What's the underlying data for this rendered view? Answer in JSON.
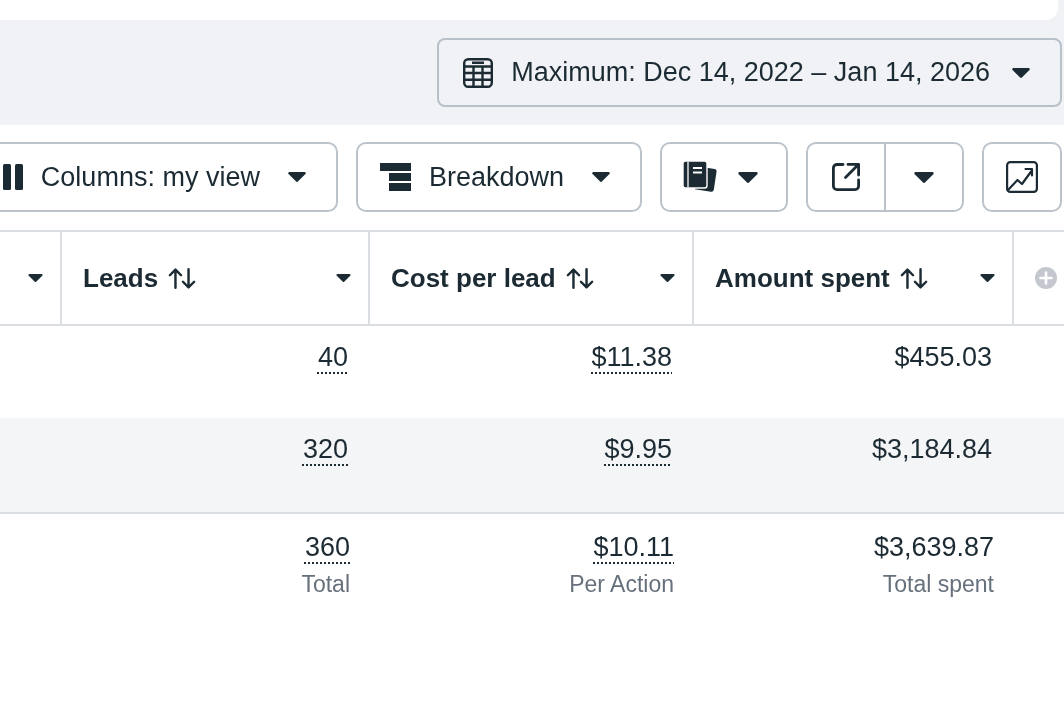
{
  "date_range_button": {
    "label": "Maximum: Dec 14, 2022 – Jan 14, 2026"
  },
  "toolbar": [
    {
      "kind": "dropdown",
      "label": "Columns: my view"
    },
    {
      "kind": "dropdown",
      "label": "Breakdown"
    },
    {
      "kind": "icon_dropdown"
    },
    {
      "kind": "split"
    },
    {
      "kind": "icon"
    }
  ],
  "table": {
    "columns": [
      {
        "label": "Leads",
        "dotted_values": true
      },
      {
        "label": "Cost per lead",
        "dotted_values": true
      },
      {
        "label": "Amount spent",
        "dotted_values": false
      }
    ],
    "rows": [
      {
        "cells": [
          "40",
          "$11.38",
          "$455.03"
        ]
      },
      {
        "cells": [
          "320",
          "$9.95",
          "$3,184.84"
        ]
      }
    ],
    "totals": [
      {
        "value": "360",
        "label": "Total"
      },
      {
        "value": "$10.11",
        "label": "Per Action"
      },
      {
        "value": "$3,639.87",
        "label": "Total spent"
      }
    ]
  }
}
